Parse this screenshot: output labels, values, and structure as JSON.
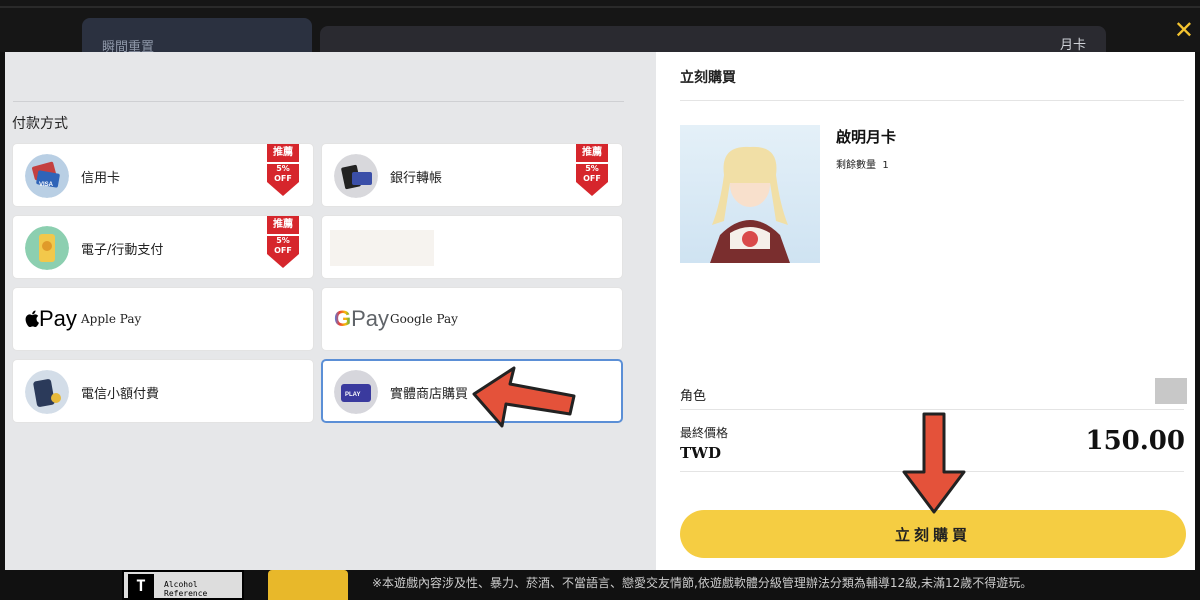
{
  "background": {
    "nav_left_label": "瞬間重置",
    "nav_right_label": "月卡",
    "close_icon": "close-x-icon",
    "rating_letter": "T",
    "rating_text": "Alcohol Reference",
    "disclaimer": "※本遊戲內容涉及性、暴力、菸酒、不當語言、戀愛交友情節,依遊戲軟體分級管理辦法分類為輔導12級,未滿12歲不得遊玩。"
  },
  "payment": {
    "section_title": "付款方式",
    "badge_label": "推薦",
    "badge_discount": "5%",
    "badge_off": "OFF",
    "methods": [
      {
        "label": "信用卡",
        "icon": "credit-card-icon",
        "badge": true
      },
      {
        "label": "銀行轉帳",
        "icon": "bank-transfer-icon",
        "badge": true
      },
      {
        "label": "電子/行動支付",
        "icon": "mobile-payment-icon",
        "badge": true
      },
      {
        "label": "",
        "icon": "",
        "badge": false
      },
      {
        "label": "Apple Pay",
        "icon": "apple-pay-icon",
        "logo": "Pay",
        "badge": false
      },
      {
        "label": "Google Pay",
        "icon": "google-pay-icon",
        "logo": "Pay",
        "badge": false
      },
      {
        "label": "電信小額付費",
        "icon": "telecom-billing-icon",
        "badge": false
      },
      {
        "label": "實體商店購買",
        "icon": "store-card-icon",
        "card_text": "PLAY",
        "badge": false,
        "selected": true
      }
    ]
  },
  "order": {
    "title": "立刻購買",
    "product_name": "啟明月卡",
    "stock_label": "剩餘數量",
    "stock_value": "1",
    "role_label": "角色",
    "final_price_label": "最終價格",
    "currency": "TWD",
    "price": "150.00",
    "buy_button_label": "立刻購買"
  },
  "colors": {
    "accent_yellow": "#f5cd42",
    "badge_red": "#d6262c",
    "annotation_arrow": "#e4523a",
    "selected_border": "#5b8fd6"
  }
}
